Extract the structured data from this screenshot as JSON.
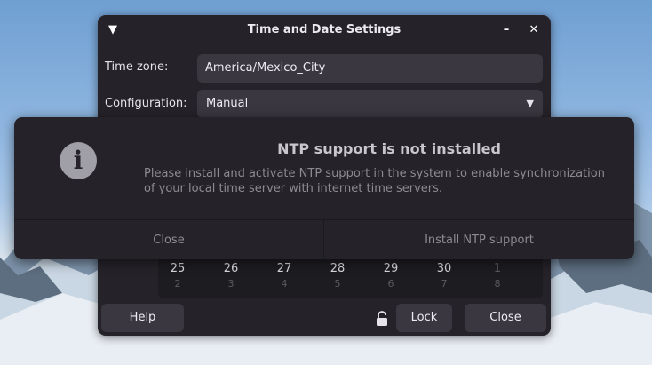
{
  "window": {
    "title": "Time and Date Settings",
    "menu_icon": "chevron-down-icon",
    "minimize_icon": "minimize-icon",
    "close_icon": "close-icon"
  },
  "timezone": {
    "label": "Time zone:",
    "value": "America/Mexico_City"
  },
  "configuration": {
    "label": "Configuration:",
    "value": "Manual"
  },
  "calendar": {
    "days": [
      "25",
      "26",
      "27",
      "28",
      "29",
      "30",
      "1"
    ],
    "weeks": [
      "2",
      "3",
      "4",
      "5",
      "6",
      "7",
      "8"
    ]
  },
  "footer": {
    "help_label": "Help",
    "lock_label": "Lock",
    "close_label": "Close",
    "lock_icon": "unlocked-padlock-icon"
  },
  "dialog": {
    "title": "NTP support is not installed",
    "message": "Please install and activate NTP support in the system to enable synchronization of your local time server with internet time servers.",
    "icon": "info-icon",
    "close_label": "Close",
    "install_label": "Install NTP support"
  },
  "colors": {
    "window_bg": "#252329",
    "field_bg": "#3a3740",
    "dialog_text": "#8d8a93"
  }
}
